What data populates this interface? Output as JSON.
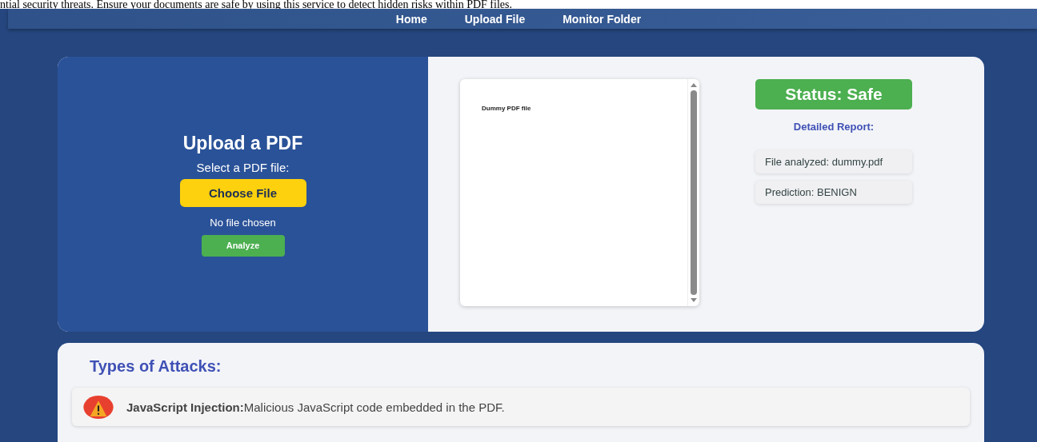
{
  "intro_text": "ntial security threats. Ensure your documents are safe by using this service to detect hidden risks within PDF files.",
  "nav": [
    {
      "label": "Home"
    },
    {
      "label": "Upload File"
    },
    {
      "label": "Monitor Folder"
    }
  ],
  "upload": {
    "title": "Upload a PDF",
    "select_label": "Select a PDF file:",
    "choose_button": "Choose File",
    "file_status": "No file chosen",
    "analyze_button": "Analyze"
  },
  "preview": {
    "page_text": "Dummy PDF file"
  },
  "result": {
    "status": "Status: Safe",
    "safe": true,
    "report_title": "Detailed Report:",
    "report_items": [
      "File analyzed: dummy.pdf",
      "Prediction: BENIGN"
    ]
  },
  "attacks": {
    "title": "Types of Attacks:",
    "items": [
      {
        "name": "JavaScript Injection:",
        "description": "Malicious JavaScript code embedded in the PDF."
      }
    ]
  }
}
